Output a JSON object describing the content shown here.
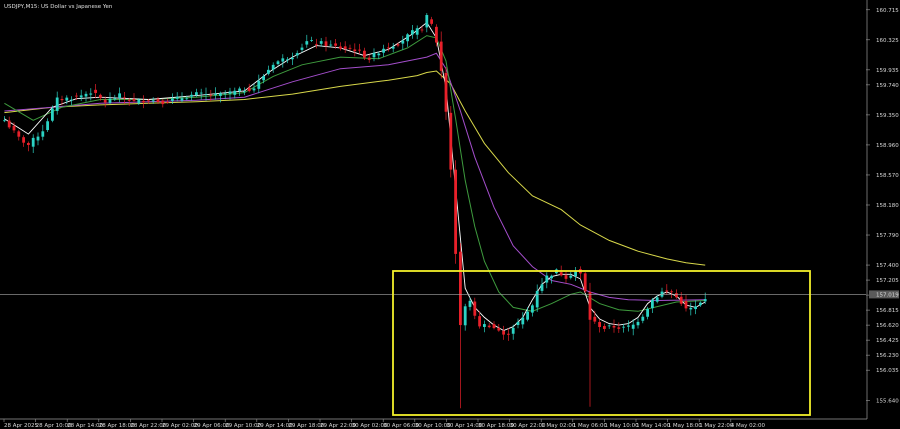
{
  "window": {
    "title": "USDJPY,M15: US Dollar vs Japanese Yen"
  },
  "colors": {
    "background": "#000000",
    "bull_candle": "#2bd3c4",
    "bear_candle": "#e8202a",
    "ma_fast": "#ffffff",
    "ma_green": "#3e9b3e",
    "ma_purple": "#a44ecc",
    "ma_yellow": "#d8d84a",
    "price_line": "#a8a8a8",
    "highlight_box": "#f2ef2a",
    "axis": "#9a9a9a"
  },
  "chart_data": {
    "type": "line",
    "title": "USDJPY,M15: US Dollar vs Japanese Yen",
    "x_labels": [
      "28 Apr 2025",
      "28 Apr 10:00",
      "28 Apr 14:00",
      "28 Apr 18:00",
      "28 Apr 22:00",
      "29 Apr 02:00",
      "29 Apr 06:00",
      "29 Apr 10:00",
      "29 Apr 14:00",
      "29 Apr 18:00",
      "29 Apr 22:00",
      "30 Apr 02:00",
      "30 Apr 06:00",
      "30 Apr 10:00",
      "30 Apr 14:00",
      "30 Apr 18:00",
      "30 Apr 22:00",
      "1 May 02:00",
      "1 May 06:00",
      "1 May 10:00",
      "1 May 14:00",
      "1 May 18:00",
      "1 May 22:00",
      "4 May 02:00"
    ],
    "y_ticks": [
      "160.715",
      "160.325",
      "159.935",
      "159.740",
      "159.350",
      "158.960",
      "158.570",
      "158.180",
      "157.790",
      "157.400",
      "157.205",
      "157.010",
      "156.815",
      "156.620",
      "156.425",
      "156.230",
      "156.035",
      "155.640"
    ],
    "current_price_label": "157.019",
    "ylim": [
      155.44,
      160.79
    ],
    "grid": false,
    "series": [
      {
        "role": "close",
        "points": [
          [
            0,
            159.28
          ],
          [
            3,
            159.05
          ],
          [
            5,
            158.96
          ],
          [
            8,
            159.15
          ],
          [
            11,
            159.55
          ],
          [
            15,
            159.58
          ],
          [
            18,
            159.65
          ],
          [
            21,
            159.52
          ],
          [
            24,
            159.6
          ],
          [
            27,
            159.52
          ],
          [
            30,
            159.55
          ],
          [
            33,
            159.52
          ],
          [
            36,
            159.56
          ],
          [
            40,
            159.62
          ],
          [
            44,
            159.6
          ],
          [
            48,
            159.65
          ],
          [
            52,
            159.7
          ],
          [
            56,
            160.02
          ],
          [
            60,
            160.12
          ],
          [
            63,
            160.3
          ],
          [
            66,
            160.28
          ],
          [
            70,
            160.22
          ],
          [
            73,
            160.2
          ],
          [
            76,
            160.08
          ],
          [
            79,
            160.22
          ],
          [
            82,
            160.28
          ],
          [
            85,
            160.42
          ],
          [
            87,
            160.48
          ],
          [
            88,
            160.62
          ],
          [
            89,
            160.52
          ],
          [
            90,
            160.3
          ],
          [
            91,
            159.92
          ],
          [
            92,
            159.4
          ],
          [
            93,
            158.65
          ],
          [
            94,
            157.55
          ],
          [
            95,
            156.62
          ],
          [
            96,
            156.85
          ],
          [
            97,
            156.95
          ],
          [
            98,
            156.72
          ],
          [
            99,
            156.62
          ],
          [
            101,
            156.62
          ],
          [
            103,
            156.55
          ],
          [
            104,
            156.48
          ],
          [
            105,
            156.52
          ],
          [
            106,
            156.6
          ],
          [
            108,
            156.7
          ],
          [
            110,
            156.88
          ],
          [
            111,
            157.08
          ],
          [
            113,
            157.25
          ],
          [
            115,
            157.32
          ],
          [
            117,
            157.25
          ],
          [
            119,
            157.32
          ],
          [
            120,
            157.28
          ],
          [
            121,
            157.05
          ],
          [
            122,
            156.7
          ],
          [
            123,
            156.65
          ],
          [
            125,
            156.58
          ],
          [
            127,
            156.6
          ],
          [
            129,
            156.58
          ],
          [
            131,
            156.62
          ],
          [
            133,
            156.75
          ],
          [
            135,
            156.95
          ],
          [
            137,
            157.05
          ],
          [
            139,
            157.05
          ],
          [
            140,
            156.98
          ],
          [
            141,
            156.92
          ],
          [
            142,
            156.82
          ],
          [
            144,
            156.85
          ],
          [
            145,
            156.9
          ],
          [
            146,
            156.95
          ]
        ]
      },
      {
        "role": "ma_fast",
        "points": [
          [
            0,
            159.3
          ],
          [
            5,
            159.1
          ],
          [
            10,
            159.45
          ],
          [
            15,
            159.56
          ],
          [
            20,
            159.58
          ],
          [
            30,
            159.55
          ],
          [
            40,
            159.6
          ],
          [
            50,
            159.66
          ],
          [
            55,
            159.9
          ],
          [
            60,
            160.1
          ],
          [
            65,
            160.25
          ],
          [
            70,
            160.22
          ],
          [
            75,
            160.12
          ],
          [
            80,
            160.2
          ],
          [
            85,
            160.4
          ],
          [
            88,
            160.55
          ],
          [
            90,
            160.35
          ],
          [
            92,
            159.7
          ],
          [
            94,
            158.4
          ],
          [
            96,
            157.1
          ],
          [
            98,
            156.85
          ],
          [
            100,
            156.72
          ],
          [
            102,
            156.62
          ],
          [
            104,
            156.55
          ],
          [
            106,
            156.6
          ],
          [
            108,
            156.72
          ],
          [
            110,
            156.95
          ],
          [
            112,
            157.15
          ],
          [
            114,
            157.25
          ],
          [
            116,
            157.28
          ],
          [
            118,
            157.28
          ],
          [
            120,
            157.22
          ],
          [
            122,
            156.85
          ],
          [
            124,
            156.7
          ],
          [
            126,
            156.64
          ],
          [
            128,
            156.62
          ],
          [
            130,
            156.64
          ],
          [
            132,
            156.72
          ],
          [
            134,
            156.9
          ],
          [
            136,
            157.0
          ],
          [
            138,
            157.05
          ],
          [
            140,
            157.0
          ],
          [
            142,
            156.88
          ],
          [
            144,
            156.85
          ],
          [
            146,
            156.92
          ]
        ]
      },
      {
        "role": "ma_green",
        "points": [
          [
            0,
            159.5
          ],
          [
            6,
            159.28
          ],
          [
            12,
            159.45
          ],
          [
            20,
            159.55
          ],
          [
            30,
            159.55
          ],
          [
            40,
            159.58
          ],
          [
            50,
            159.64
          ],
          [
            56,
            159.85
          ],
          [
            62,
            160.0
          ],
          [
            70,
            160.1
          ],
          [
            78,
            160.08
          ],
          [
            84,
            160.22
          ],
          [
            88,
            160.38
          ],
          [
            90,
            160.35
          ],
          [
            92,
            160.05
          ],
          [
            94,
            159.3
          ],
          [
            96,
            158.5
          ],
          [
            98,
            157.9
          ],
          [
            100,
            157.45
          ],
          [
            103,
            157.05
          ],
          [
            106,
            156.85
          ],
          [
            110,
            156.8
          ],
          [
            114,
            156.9
          ],
          [
            118,
            157.02
          ],
          [
            120,
            157.05
          ],
          [
            124,
            156.9
          ],
          [
            128,
            156.82
          ],
          [
            132,
            156.8
          ],
          [
            136,
            156.86
          ],
          [
            140,
            156.92
          ],
          [
            146,
            156.94
          ]
        ]
      },
      {
        "role": "ma_purple",
        "points": [
          [
            0,
            159.4
          ],
          [
            10,
            159.45
          ],
          [
            20,
            159.5
          ],
          [
            30,
            159.52
          ],
          [
            40,
            159.54
          ],
          [
            50,
            159.58
          ],
          [
            60,
            159.78
          ],
          [
            70,
            159.95
          ],
          [
            80,
            160.0
          ],
          [
            88,
            160.1
          ],
          [
            90,
            160.15
          ],
          [
            92,
            159.95
          ],
          [
            95,
            159.4
          ],
          [
            98,
            158.8
          ],
          [
            102,
            158.15
          ],
          [
            106,
            157.65
          ],
          [
            110,
            157.38
          ],
          [
            114,
            157.2
          ],
          [
            118,
            157.15
          ],
          [
            122,
            157.05
          ],
          [
            126,
            156.98
          ],
          [
            130,
            156.95
          ],
          [
            136,
            156.94
          ],
          [
            146,
            156.95
          ]
        ]
      },
      {
        "role": "ma_yellow",
        "points": [
          [
            0,
            159.38
          ],
          [
            10,
            159.45
          ],
          [
            20,
            159.48
          ],
          [
            30,
            159.5
          ],
          [
            40,
            159.52
          ],
          [
            50,
            159.55
          ],
          [
            60,
            159.62
          ],
          [
            70,
            159.72
          ],
          [
            80,
            159.8
          ],
          [
            86,
            159.86
          ],
          [
            88,
            159.9
          ],
          [
            90,
            159.92
          ],
          [
            93,
            159.75
          ],
          [
            96,
            159.4
          ],
          [
            100,
            158.98
          ],
          [
            105,
            158.6
          ],
          [
            110,
            158.3
          ],
          [
            116,
            158.12
          ],
          [
            120,
            157.92
          ],
          [
            126,
            157.72
          ],
          [
            132,
            157.58
          ],
          [
            138,
            157.48
          ],
          [
            142,
            157.43
          ],
          [
            146,
            157.4
          ]
        ]
      }
    ]
  }
}
